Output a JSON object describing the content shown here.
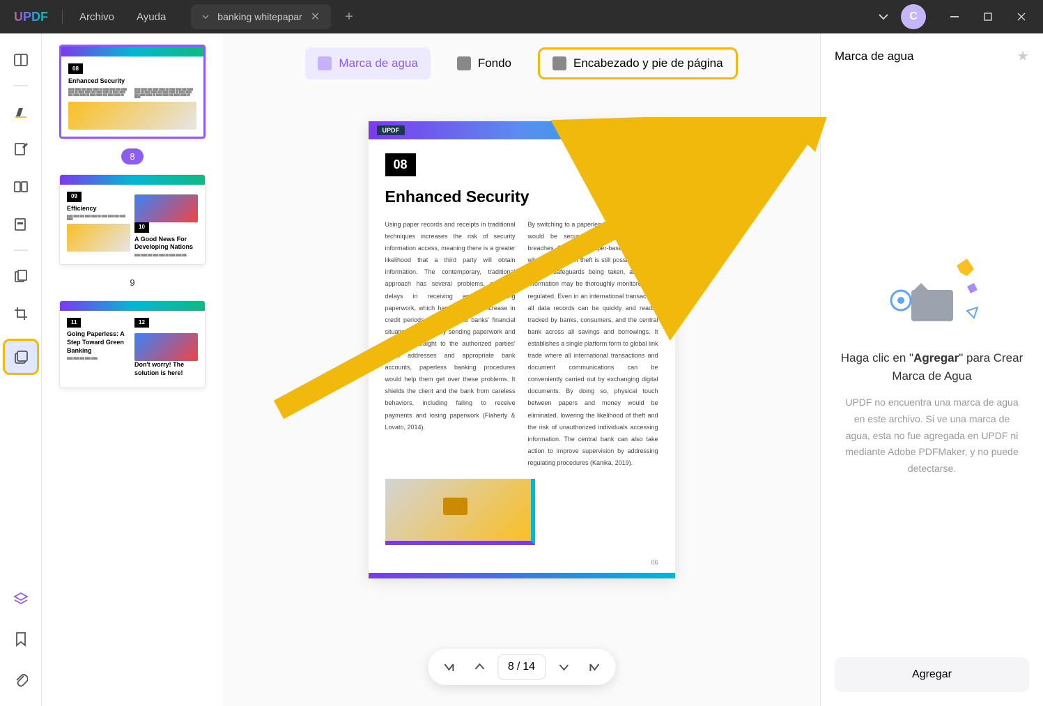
{
  "app": {
    "logo": "UPDF"
  },
  "menu": {
    "file": "Archivo",
    "help": "Ayuda"
  },
  "tab": {
    "title": "banking whitepapar"
  },
  "avatar": {
    "initial": "C"
  },
  "topTabs": {
    "watermark": "Marca de agua",
    "background": "Fondo",
    "headerFooter": "Encabezado y pie de página"
  },
  "thumbnails": {
    "page8": {
      "num": "8",
      "badge": "08",
      "title": "Enhanced Security"
    },
    "page9": {
      "num": "9",
      "badge1": "09",
      "title1": "Efficiency",
      "badge2": "10",
      "title2": "A Good News For Developing Nations"
    },
    "page10": {
      "badge1": "11",
      "title1": "Going Paperless: A Step Toward Green Banking",
      "badge2": "12",
      "title2": "Don't worry! The solution is here!"
    }
  },
  "page": {
    "logo": "UPDF",
    "badge": "08",
    "title": "Enhanced Security",
    "col1": "Using paper records and receipts in traditional techniques increases the risk of security information access, meaning there is a greater likelihood that a third party will obtain information. The contemporary, traditional approach has several problems, such as delays in receiving and transmitting paperwork, which has caused an increase in credit periods and made the banks' financial situation unstable. By sending paperwork and payments straight to the authorized parties' email addresses and appropriate bank accounts, paperless banking procedures would help them get over these problems. It shields the client and the bank from careless behaviors, including failing to receive payments and losing paperwork (Flaherty & Lovato, 2014).",
    "col2": "By switching to a paperless workplace, all data would be secured, preventing any data breaches. Contrary to paper-based databases, where information theft is still possible despite multiple safeguards being taken, access to information may be thoroughly monitored and regulated. Even in an international transaction, all data records can be quickly and readily tracked by banks, consumers, and the central bank across all savings and borrowings. It establishes a single platform form to global link trade where all international transactions and document communications can be conveniently carried out by exchanging digital documents. By doing so, physical touch between papers and money would be eliminated, lowering the likelihood of theft and the risk of unauthorized individuals accessing information. The central bank can also take action to improve supervision by addressing regulating procedures (Kanika, 2019).",
    "num": "06"
  },
  "nav": {
    "current": "8",
    "total": "14",
    "sep": "/"
  },
  "rightPanel": {
    "title": "Marca de agua",
    "msgPrefix": "Haga clic en \"",
    "msgBold": "Agregar",
    "msgSuffix": "\" para Crear Marca de Agua",
    "desc": "UPDF no encuentra una marca de agua en este archivo. Si ve una marca de agua, esta no fue agregada en UPDF ni mediante Adobe PDFMaker, y no puede detectarse.",
    "addBtn": "Agregar"
  }
}
